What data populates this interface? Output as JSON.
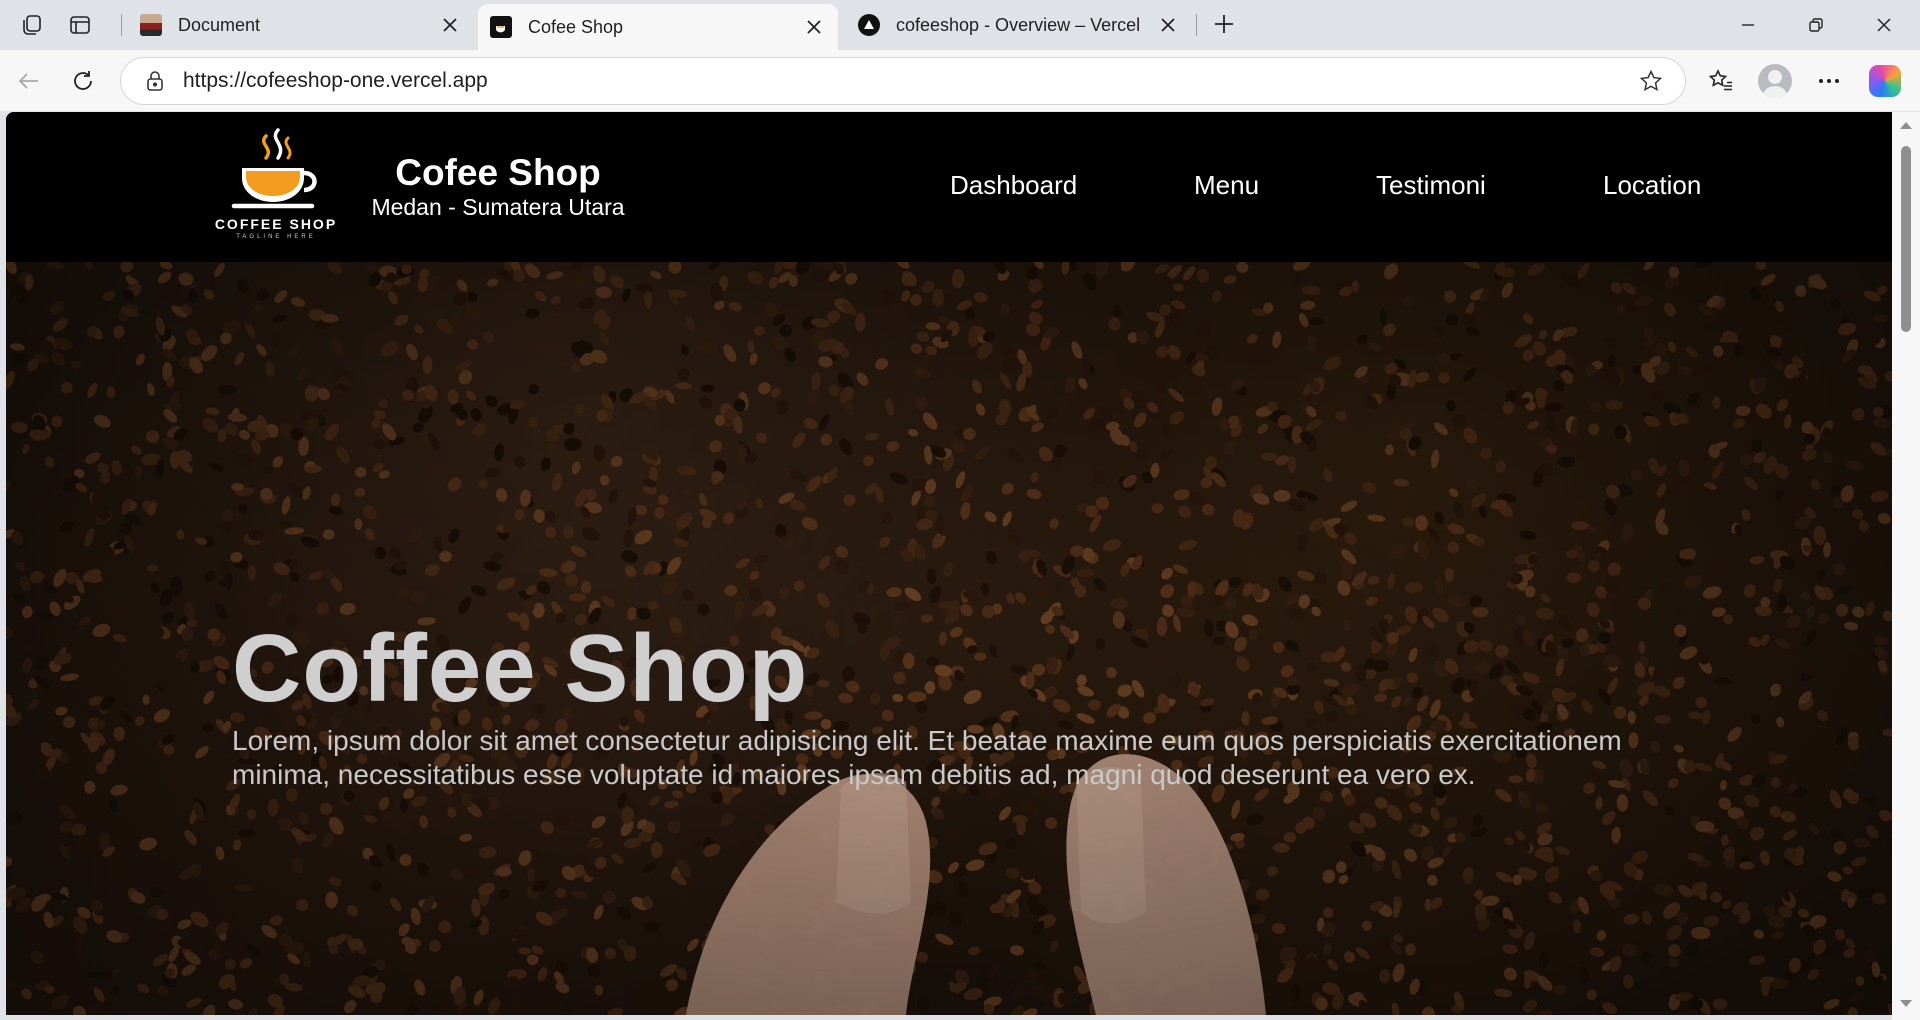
{
  "browser": {
    "tabs": [
      {
        "title": "Document",
        "active": false
      },
      {
        "title": "Cofee Shop",
        "active": true
      },
      {
        "title": "cofeeshop - Overview – Vercel",
        "active": false
      }
    ],
    "url": "https://cofeeshop-one.vercel.app"
  },
  "site": {
    "logo": {
      "text": "COFFEE SHOP",
      "tagline": "TAGLINE HERE"
    },
    "brand_name": "Cofee Shop",
    "brand_sub": "Medan - Sumatera Utara",
    "nav": [
      "Dashboard",
      "Menu",
      "Testimoni",
      "Location"
    ],
    "hero": {
      "title": "Coffee Shop",
      "text": "Lorem, ipsum dolor sit amet consectetur adipisicing elit. Et beatae maxime eum quos perspiciatis exercitationem minima, necessitatibus esse voluptate id maiores ipsam debitis ad, magni quod deserunt ea vero ex."
    }
  },
  "colors": {
    "header_bg": "#000000",
    "cup_accent": "#f39c1f",
    "hero_text": "#c9c9c9"
  },
  "icons": [
    "workspaces-icon",
    "tab-actions-icon",
    "close-icon",
    "new-tab-icon",
    "minimize-icon",
    "restore-icon",
    "back-icon",
    "refresh-icon",
    "lock-icon",
    "favorite-star-icon",
    "favorites-icon",
    "profile-avatar",
    "more-icon",
    "copilot-icon",
    "coffee-cup-icon"
  ]
}
